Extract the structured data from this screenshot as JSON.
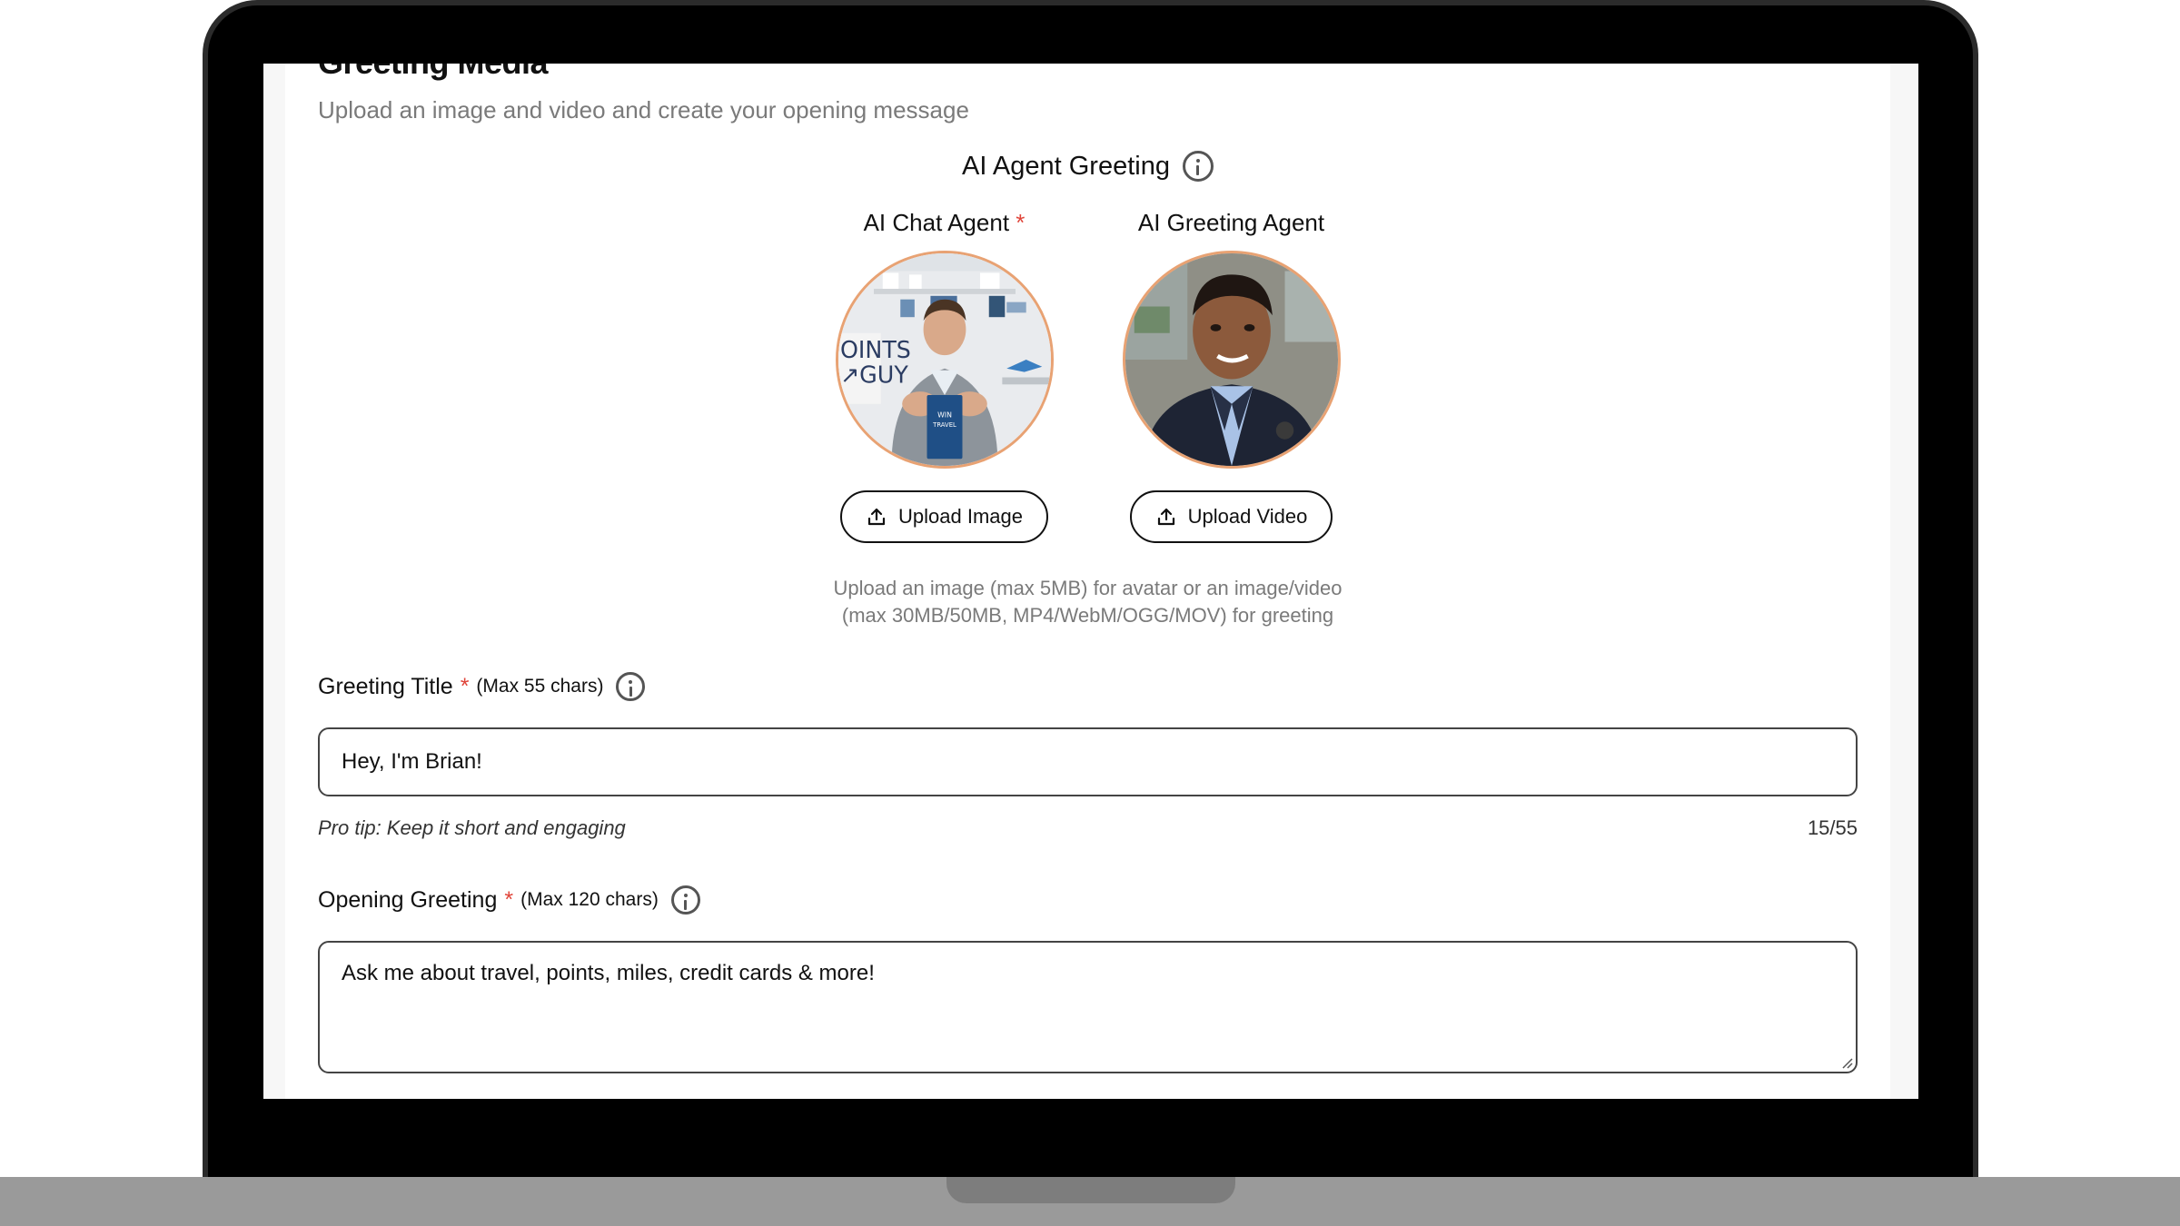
{
  "section": {
    "title": "Greeting Media",
    "subtitle": "Upload an image and video and create your opening message"
  },
  "agent_greeting": {
    "heading": "AI Agent Greeting",
    "info_icon": "info-icon"
  },
  "agents": [
    {
      "label": "AI Chat Agent",
      "required_mark": "*",
      "upload_label": "Upload Image",
      "upload_icon": "upload-icon"
    },
    {
      "label": "AI Greeting Agent",
      "required_mark": "",
      "upload_label": "Upload Video",
      "upload_icon": "upload-icon"
    }
  ],
  "upload_hint": {
    "line1": "Upload an image (max 5MB) for avatar or an image/video",
    "line2": "(max 30MB/50MB, MP4/WebM/OGG/MOV) for greeting"
  },
  "greeting_title": {
    "label": "Greeting Title",
    "required_mark": "*",
    "max_label": "(Max 55 chars)",
    "value": "Hey, I'm Brian!",
    "pro_tip": "Pro tip: Keep it short and engaging",
    "counter": "15/55"
  },
  "opening_greeting": {
    "label": "Opening Greeting",
    "required_mark": "*",
    "max_label": "(Max 120 chars)",
    "value": "Ask me about travel, points, miles, credit cards & more!"
  },
  "colors": {
    "required": "#e0453a",
    "avatar_border": "#e8a273",
    "muted_text": "#7a7a7a"
  }
}
